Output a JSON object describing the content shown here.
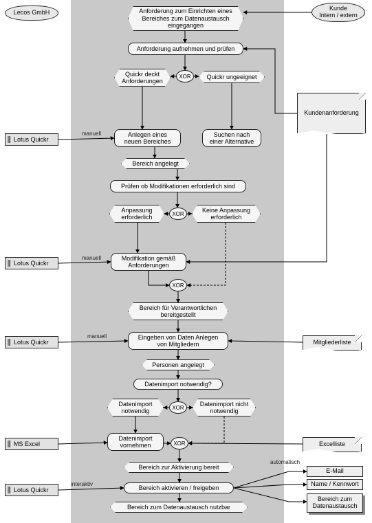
{
  "org": {
    "lecos": "Lecos GmbH",
    "kunde_l1": "Kunde",
    "kunde_l2": "Intern / extern"
  },
  "sys": {
    "lq1": "Lotus Quickr",
    "lq2": "Lotus Quickr",
    "lq3": "Lotus Quickr",
    "lq4": "Lotus Quickr",
    "excel": "MS Excel"
  },
  "docs": {
    "kunden": "Kundenanforderung",
    "mitglieder": "Mitgliederliste",
    "excelliste": "Excelliste"
  },
  "out": {
    "email": "E-Mail",
    "namekw": "Name / Kennwort",
    "bereich": "Bereich zum Datenaustausch"
  },
  "labels": {
    "manuell": "manuell",
    "interaktiv": "interaktiv",
    "automatisch": "automatisch",
    "xor": "XOR"
  },
  "flow": {
    "start": "Anforderung zum Einrichten eines Bereiches zum Datenaustausch eingegangen",
    "aufnehmen": "Anforderung aufnehmen und prüfen",
    "deckt": "Quickr deckt Anforderungen",
    "ungeeignet": "Quickr ungeeignet",
    "anlegen": "Anlegen eines neuen Bereiches",
    "alternative": "Suchen nach einer Alternative",
    "angelegt": "Bereich angelegt",
    "pruefenmod": "Prüfen ob Modifikationen erforderlich sind",
    "anp_erf": "Anpassung erforderlich",
    "keine_anp": "Keine Anpassung erforderlich",
    "modifikation": "Modifikation gemäß Anforderungen",
    "bereit": "Bereich für Verantwortlichen bereitgestellt",
    "eingeben": "Eingeben von Daten Anlegen von Mitgliedern",
    "personen": "Personen angelegt",
    "impfrage": "Datenimport notwendig?",
    "imp_not": "Datenimport notwendig",
    "imp_nnot": "Datenimport nicht notwendig",
    "imp_vorn": "Datenimport vornehmen",
    "aktbereit": "Bereich zur Aktivierung bereit",
    "aktivieren": "Bereich aktivieren / freigeben",
    "nutzbar": "Bereich zum Datenaustausch nutzbar"
  },
  "chart_data": {
    "type": "table",
    "title": "EPK: Bereich zum Datenaustausch einrichten (Lotus Quickr)",
    "nodes": [
      {
        "id": "org_lecos",
        "type": "org",
        "label": "Lecos GmbH"
      },
      {
        "id": "org_kunde",
        "type": "org",
        "label": "Kunde Intern / extern"
      },
      {
        "id": "e_start",
        "type": "event",
        "label": "Anforderung zum Einrichten eines Bereiches zum Datenaustausch eingegangen"
      },
      {
        "id": "f_aufnehmen",
        "type": "function",
        "label": "Anforderung aufnehmen und prüfen"
      },
      {
        "id": "x1",
        "type": "xor"
      },
      {
        "id": "e_deckt",
        "type": "event",
        "label": "Quickr deckt Anforderungen"
      },
      {
        "id": "e_ungeeignet",
        "type": "event",
        "label": "Quickr ungeeignet"
      },
      {
        "id": "f_anlegen",
        "type": "function",
        "label": "Anlegen eines neuen Bereiches"
      },
      {
        "id": "f_alternative",
        "type": "function",
        "label": "Suchen nach einer Alternative"
      },
      {
        "id": "e_angelegt",
        "type": "event",
        "label": "Bereich angelegt"
      },
      {
        "id": "f_pruefenmod",
        "type": "function",
        "label": "Prüfen ob Modifikationen erforderlich sind"
      },
      {
        "id": "x2",
        "type": "xor"
      },
      {
        "id": "e_anp_erf",
        "type": "event",
        "label": "Anpassung erforderlich"
      },
      {
        "id": "e_keine_anp",
        "type": "event",
        "label": "Keine Anpassung erforderlich"
      },
      {
        "id": "f_modifikation",
        "type": "function",
        "label": "Modifikation gemäß Anforderungen"
      },
      {
        "id": "x3",
        "type": "xor"
      },
      {
        "id": "e_bereit",
        "type": "event",
        "label": "Bereich für Verantwortlichen bereitgestellt"
      },
      {
        "id": "f_eingeben",
        "type": "function",
        "label": "Eingeben von Daten Anlegen von Mitgliedern"
      },
      {
        "id": "e_personen",
        "type": "event",
        "label": "Personen angelegt"
      },
      {
        "id": "f_impfrage",
        "type": "function",
        "label": "Datenimport notwendig?"
      },
      {
        "id": "x4",
        "type": "xor"
      },
      {
        "id": "e_imp_not",
        "type": "event",
        "label": "Datenimport notwendig"
      },
      {
        "id": "e_imp_nnot",
        "type": "event",
        "label": "Datenimport nicht notwendig"
      },
      {
        "id": "f_imp_vorn",
        "type": "function",
        "label": "Datenimport vornehmen"
      },
      {
        "id": "x5",
        "type": "xor"
      },
      {
        "id": "e_aktbereit",
        "type": "event",
        "label": "Bereich zur Aktivierung bereit"
      },
      {
        "id": "f_aktivieren",
        "type": "function",
        "label": "Bereich aktivieren / freigeben"
      },
      {
        "id": "e_nutzbar",
        "type": "event",
        "label": "Bereich zum Datenaustausch nutzbar"
      },
      {
        "id": "sys_lq",
        "type": "system",
        "label": "Lotus Quickr"
      },
      {
        "id": "sys_excel",
        "type": "system",
        "label": "MS Excel"
      },
      {
        "id": "doc_kunden",
        "type": "document",
        "label": "Kundenanforderung"
      },
      {
        "id": "doc_mitglieder",
        "type": "document",
        "label": "Mitgliederliste"
      },
      {
        "id": "doc_excel",
        "type": "document",
        "label": "Excelliste"
      },
      {
        "id": "out_email",
        "type": "output",
        "label": "E-Mail"
      },
      {
        "id": "out_namekw",
        "type": "output",
        "label": "Name / Kennwort"
      },
      {
        "id": "out_bereich",
        "type": "output",
        "label": "Bereich zum Datenaustausch"
      }
    ],
    "edges": [
      {
        "from": "org_kunde",
        "to": "e_start"
      },
      {
        "from": "e_start",
        "to": "f_aufnehmen"
      },
      {
        "from": "f_aufnehmen",
        "to": "x1"
      },
      {
        "from": "x1",
        "to": "e_deckt"
      },
      {
        "from": "x1",
        "to": "e_ungeeignet"
      },
      {
        "from": "e_deckt",
        "to": "f_anlegen"
      },
      {
        "from": "e_ungeeignet",
        "to": "f_alternative"
      },
      {
        "from": "f_anlegen",
        "to": "e_angelegt"
      },
      {
        "from": "e_angelegt",
        "to": "f_pruefenmod"
      },
      {
        "from": "f_pruefenmod",
        "to": "x2"
      },
      {
        "from": "x2",
        "to": "e_anp_erf"
      },
      {
        "from": "x2",
        "to": "e_keine_anp"
      },
      {
        "from": "e_anp_erf",
        "to": "f_modifikation"
      },
      {
        "from": "f_modifikation",
        "to": "x3"
      },
      {
        "from": "e_keine_anp",
        "to": "x3",
        "style": "dashed"
      },
      {
        "from": "x3",
        "to": "e_bereit"
      },
      {
        "from": "e_bereit",
        "to": "f_eingeben"
      },
      {
        "from": "f_eingeben",
        "to": "e_personen"
      },
      {
        "from": "e_personen",
        "to": "f_impfrage"
      },
      {
        "from": "f_impfrage",
        "to": "x4"
      },
      {
        "from": "x4",
        "to": "e_imp_not"
      },
      {
        "from": "x4",
        "to": "e_imp_nnot"
      },
      {
        "from": "e_imp_not",
        "to": "f_imp_vorn"
      },
      {
        "from": "f_imp_vorn",
        "to": "x5"
      },
      {
        "from": "e_imp_nnot",
        "to": "x5",
        "style": "dashed"
      },
      {
        "from": "x5",
        "to": "e_aktbereit"
      },
      {
        "from": "e_aktbereit",
        "to": "f_aktivieren"
      },
      {
        "from": "f_aktivieren",
        "to": "e_nutzbar"
      },
      {
        "from": "sys_lq",
        "to": "f_anlegen",
        "label": "manuell"
      },
      {
        "from": "sys_lq",
        "to": "f_modifikation",
        "label": "manuell"
      },
      {
        "from": "sys_lq",
        "to": "f_eingeben",
        "label": "manuell"
      },
      {
        "from": "sys_lq",
        "to": "f_aktivieren",
        "label": "interaktiv"
      },
      {
        "from": "sys_excel",
        "to": "f_imp_vorn"
      },
      {
        "from": "doc_kunden",
        "to": "f_aufnehmen"
      },
      {
        "from": "doc_kunden",
        "to": "f_modifikation"
      },
      {
        "from": "doc_mitglieder",
        "to": "f_eingeben"
      },
      {
        "from": "doc_excel",
        "to": "f_imp_vorn"
      },
      {
        "from": "f_aktivieren",
        "to": "out_email",
        "label": "automatisch"
      },
      {
        "from": "f_aktivieren",
        "to": "out_namekw",
        "label": "automatisch"
      },
      {
        "from": "f_aktivieren",
        "to": "out_bereich"
      }
    ]
  }
}
